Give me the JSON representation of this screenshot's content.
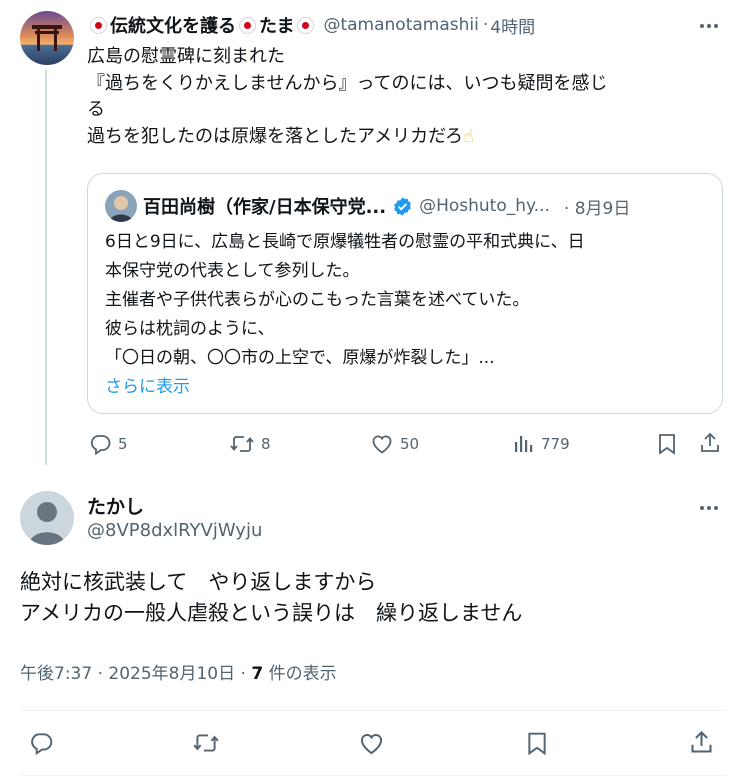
{
  "parent_tweet": {
    "display_name": "伝統文化を護る",
    "display_name_suffix": "たま",
    "handle": "@tamanotamashii",
    "time": "4時間",
    "text_lines": [
      "広島の慰霊碑に刻まれた",
      "『過ちをくりかえしませんから』ってのには、いつも疑問を感じ",
      "る",
      "過ちを犯したのは原爆を落としたアメリカだろ"
    ],
    "emoji": "☝",
    "quote": {
      "display_name": "百田尚樹（作家/日本保守党...",
      "handle": "@Hoshuto_hy...",
      "date": "8月9日",
      "text_lines": [
        "6日と9日に、広島と長崎で原爆犠牲者の慰霊の平和式典に、日",
        "本保守党の代表として参列した。",
        "主催者や子供代表らが心のこもった言葉を述べていた。",
        "彼らは枕詞のように、",
        "「〇日の朝、〇〇市の上空で、原爆が炸裂した」..."
      ],
      "show_more": "さらに表示"
    },
    "actions": {
      "replies": "5",
      "reposts": "8",
      "likes": "50",
      "views": "779"
    }
  },
  "reply_tweet": {
    "display_name": "たかし",
    "handle": "@8VP8dxlRYVjWyju",
    "text_lines": [
      "絶対に核武装して　やり返しますから",
      "アメリカの一般人虐殺という誤りは　繰り返しません"
    ],
    "time": "午後7:37",
    "date": "2025年8月10日",
    "view_count": "7",
    "view_label": "件の表示"
  },
  "colors": {
    "text": "#0f1419",
    "secondary": "#536471",
    "link": "#1d9bf0",
    "border": "#cfd9de",
    "flag_red": "#d0021b",
    "verified": "#1d9bf0"
  },
  "icons": [
    "more-icon",
    "reply-icon",
    "repost-icon",
    "like-icon",
    "views-icon",
    "bookmark-icon",
    "share-icon",
    "verified-icon"
  ]
}
